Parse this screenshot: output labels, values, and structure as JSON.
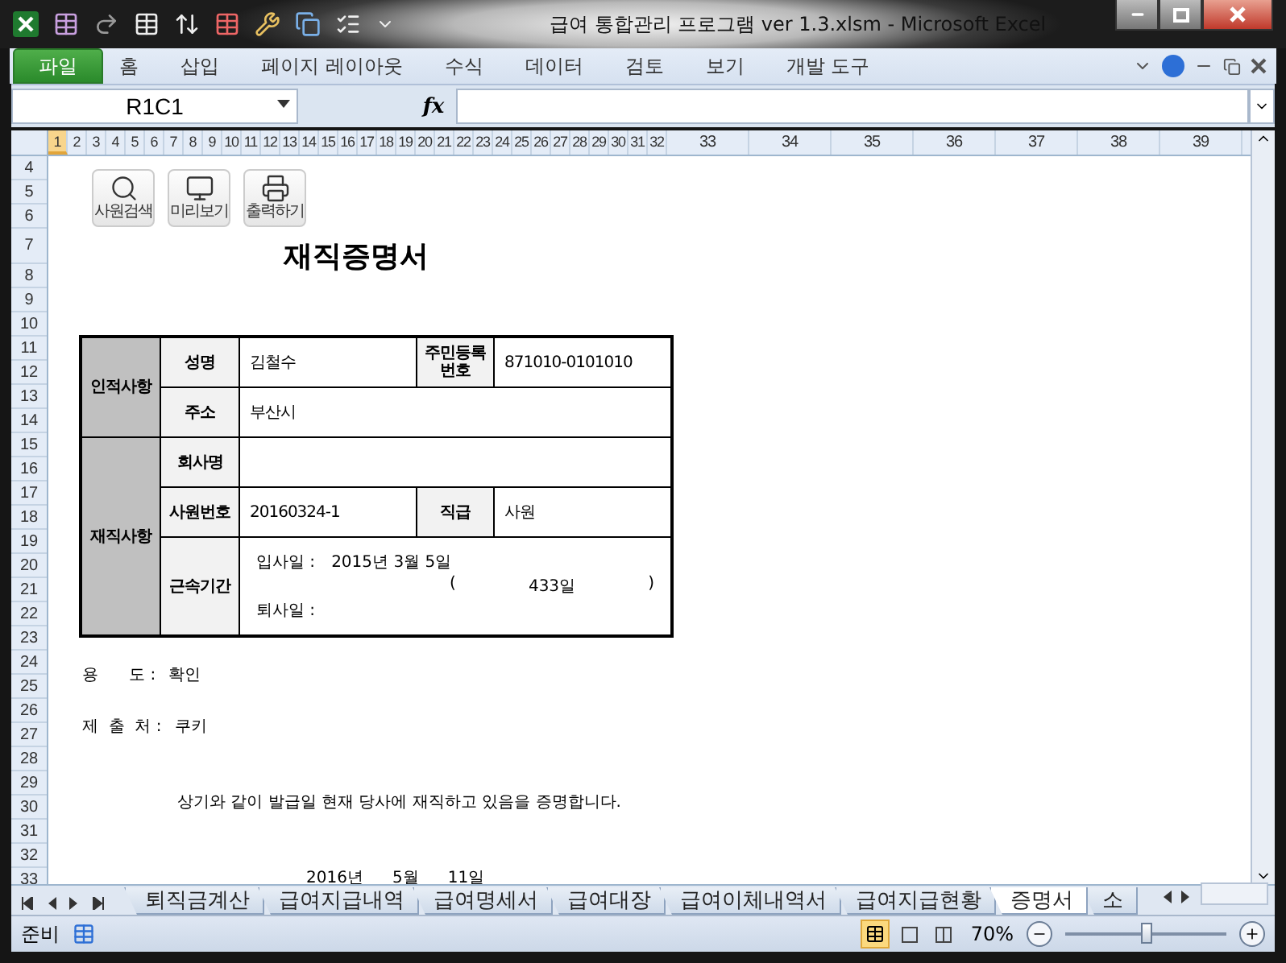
{
  "window": {
    "title": "급여 통합관리 프로그램 ver 1.3.xlsm  -  Microsoft Excel"
  },
  "ribbon": {
    "file_tab": "파일",
    "tabs": [
      "홈",
      "삽입",
      "페이지 레이아웃",
      "수식",
      "데이터",
      "검토",
      "보기",
      "개발 도구"
    ]
  },
  "formula_bar": {
    "name_box": "R1C1",
    "function_label": "fx"
  },
  "column_headers": [
    {
      "label": "1",
      "selected": true
    },
    {
      "label": "2",
      "selected": false
    },
    {
      "label": "3",
      "selected": false
    },
    {
      "label": "4",
      "selected": false
    },
    {
      "label": "5",
      "selected": false
    },
    {
      "label": "6",
      "selected": false
    },
    {
      "label": "7",
      "selected": false
    },
    {
      "label": "8",
      "selected": false
    },
    {
      "label": "9",
      "selected": false
    },
    {
      "label": "10",
      "selected": false
    },
    {
      "label": "11",
      "selected": false
    },
    {
      "label": "12",
      "selected": false
    },
    {
      "label": "13",
      "selected": false
    },
    {
      "label": "14",
      "selected": false
    },
    {
      "label": "15",
      "selected": false
    },
    {
      "label": "16",
      "selected": false
    },
    {
      "label": "17",
      "selected": false
    },
    {
      "label": "18",
      "selected": false
    },
    {
      "label": "19",
      "selected": false
    },
    {
      "label": "20",
      "selected": false
    },
    {
      "label": "21",
      "selected": false
    },
    {
      "label": "22",
      "selected": false
    },
    {
      "label": "23",
      "selected": false
    },
    {
      "label": "24",
      "selected": false
    },
    {
      "label": "25",
      "selected": false
    },
    {
      "label": "26",
      "selected": false
    },
    {
      "label": "27",
      "selected": false
    },
    {
      "label": "28",
      "selected": false
    },
    {
      "label": "29",
      "selected": false
    },
    {
      "label": "30",
      "selected": false
    },
    {
      "label": "31",
      "selected": false
    },
    {
      "label": "32",
      "selected": false
    },
    {
      "label": "33",
      "selected": false
    },
    {
      "label": "34",
      "selected": false
    },
    {
      "label": "35",
      "selected": false
    },
    {
      "label": "36",
      "selected": false
    },
    {
      "label": "37",
      "selected": false
    },
    {
      "label": "38",
      "selected": false
    },
    {
      "label": "39",
      "selected": false
    }
  ],
  "row_headers": [
    "4",
    "5",
    "6",
    "7",
    "8",
    "9",
    "10",
    "11",
    "12",
    "13",
    "14",
    "15",
    "16",
    "17",
    "18",
    "19",
    "20",
    "21",
    "22",
    "23",
    "24",
    "25",
    "26",
    "27",
    "28",
    "29",
    "30",
    "31",
    "32",
    "33"
  ],
  "action_buttons": [
    {
      "label": "사원검색",
      "kind": "search"
    },
    {
      "label": "미리보기",
      "kind": "monitor"
    },
    {
      "label": "출력하기",
      "kind": "printer"
    }
  ],
  "document_title": "재직증명서",
  "table": {
    "personal_heading": "인적사항",
    "name_label": "성명",
    "name_value": "김철수",
    "id_label": "주민등록 번호",
    "id_value": "871010-0101010",
    "address_label": "주소",
    "address_value": "부산시",
    "employment_heading": "재직사항",
    "company_label": "회사명",
    "employee_no_label": "사원번호",
    "employee_no_value": "20160324-1",
    "position_label": "직급",
    "position_value": "사원",
    "tenure_label": "근속기간",
    "hire_label": "입사일 :",
    "hire_date": "2015년 3월 5일",
    "days_open": "(",
    "days": "433일",
    "days_close": ")",
    "leave_label": "퇴사일 :"
  },
  "purpose": {
    "label": "용      도 :",
    "value": "확인"
  },
  "submit_to": {
    "label": "제  출  처 :",
    "value": "쿠키"
  },
  "statement": "상기와 같이 발급일 현재 당사에 재직하고 있음을 증명합니다.",
  "issue_date": [
    "2016년",
    "5월",
    "11일"
  ],
  "sheet_tabs": [
    {
      "label": "퇴직금계산",
      "selected": false
    },
    {
      "label": "급여지급내역",
      "selected": false
    },
    {
      "label": "급여명세서",
      "selected": false
    },
    {
      "label": "급여대장",
      "selected": false
    },
    {
      "label": "급여이체내역서",
      "selected": false
    },
    {
      "label": "급여지급현황",
      "selected": false
    },
    {
      "label": "증명서",
      "selected": true
    },
    {
      "label": "소",
      "selected": false
    }
  ],
  "status_bar": {
    "status": "준비",
    "zoom": "70%",
    "level": 0.5
  }
}
